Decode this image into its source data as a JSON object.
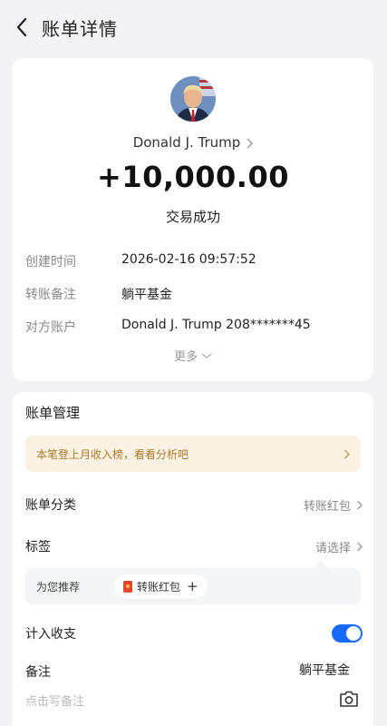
{
  "header": {
    "title": "账单详情",
    "back_icon": "chevron-left-icon"
  },
  "transaction": {
    "counterparty_name": "Donald J. Trump",
    "amount": "+10,000.00",
    "status": "交易成功",
    "details": [
      {
        "label": "创建时间",
        "value": "2026-02-16 09:57:52"
      },
      {
        "label": "转账备注",
        "value": "躺平基金"
      },
      {
        "label": "对方账户",
        "value": "Donald J. Trump 208*******45"
      }
    ],
    "more_label": "更多"
  },
  "management": {
    "title": "账单管理",
    "banner_text": "本笔登上月收入榜，看看分析吧",
    "category": {
      "label": "账单分类",
      "value": "转账红包"
    },
    "tag": {
      "label": "标签",
      "value": "请选择"
    },
    "recommend": {
      "label": "为您推荐",
      "chip": "转账红包",
      "chip_add": "+"
    },
    "include": {
      "label": "计入收支",
      "enabled": true
    },
    "note": {
      "label": "备注",
      "value": "躺平基金",
      "placeholder": "点击写备注"
    }
  },
  "colors": {
    "accent": "#1769ff",
    "banner_bg": "#fbf2e3",
    "banner_text": "#a9792d",
    "red_packet": "#e3462f"
  }
}
